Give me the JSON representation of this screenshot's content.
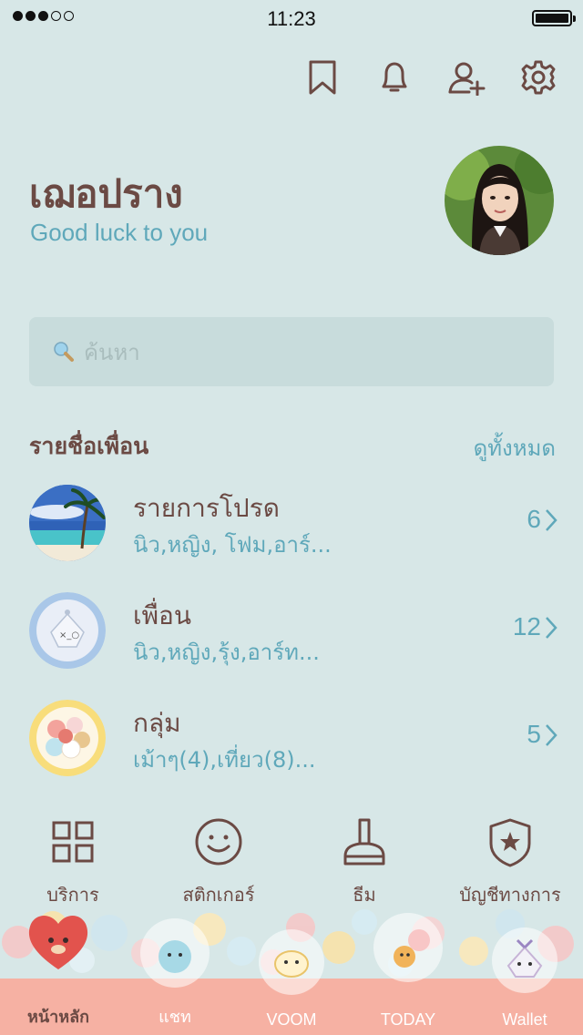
{
  "status_bar": {
    "time": "11:23",
    "signal_filled": 3,
    "signal_total": 5
  },
  "top_icons": [
    "bookmark-icon",
    "bell-icon",
    "add-friend-icon",
    "settings-icon"
  ],
  "profile": {
    "name": "เฌอปราง",
    "status": "Good luck to you"
  },
  "search": {
    "placeholder": "ค้นหา"
  },
  "friends_section": {
    "title": "รายชื่อเพื่อน",
    "see_all": "ดูทั้งหมด"
  },
  "friend_groups": [
    {
      "title": "รายการโปรด",
      "subtitle": "นิว,หญิง, โฟม,อาร์...",
      "count": "6"
    },
    {
      "title": "เพื่อน",
      "subtitle": "นิว,หญิง,รุ้ง,อาร์ท...",
      "count": "12"
    },
    {
      "title": "กลุ่ม",
      "subtitle": "เม้าๆ(4),เที่ยว(8)...",
      "count": "5"
    }
  ],
  "services": [
    {
      "label": "บริการ",
      "icon": "grid-icon"
    },
    {
      "label": "สติกเกอร์",
      "icon": "smiley-icon"
    },
    {
      "label": "ธีม",
      "icon": "brush-icon"
    },
    {
      "label": "บัญชีทางการ",
      "icon": "shield-star-icon"
    }
  ],
  "tabs": [
    {
      "label": "หน้าหลัก",
      "active": true
    },
    {
      "label": "แชท",
      "active": false
    },
    {
      "label": "VOOM",
      "active": false
    },
    {
      "label": "TODAY",
      "active": false
    },
    {
      "label": "Wallet",
      "active": false
    }
  ],
  "colors": {
    "background": "#d7e7e7",
    "text": "#6b4a44",
    "accent": "#5fa8ba",
    "tabbar": "#f6b1a3",
    "search_bg": "#c8dcdc"
  }
}
